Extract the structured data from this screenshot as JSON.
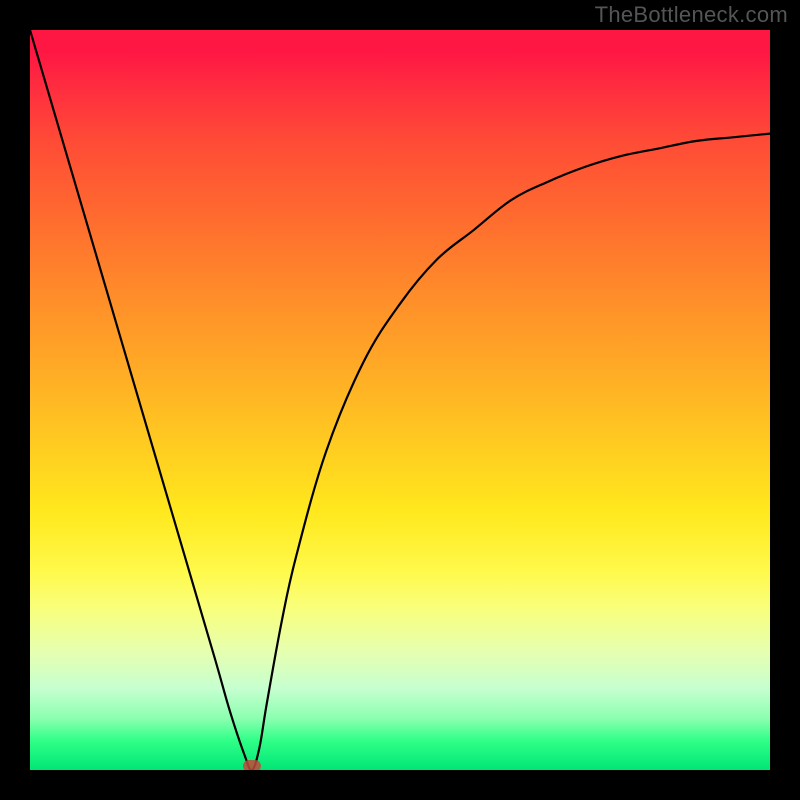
{
  "watermark": "TheBottleneck.com",
  "chart_data": {
    "type": "line",
    "title": "",
    "xlabel": "",
    "ylabel": "",
    "xlim": [
      0,
      100
    ],
    "ylim": [
      0,
      100
    ],
    "x": [
      0,
      5,
      10,
      15,
      20,
      25,
      27,
      29,
      30,
      31,
      32,
      34,
      36,
      40,
      45,
      50,
      55,
      60,
      65,
      70,
      75,
      80,
      85,
      90,
      95,
      100
    ],
    "values": [
      100,
      83,
      66,
      49,
      32,
      15,
      8,
      2,
      0,
      3,
      9,
      20,
      29,
      43,
      55,
      63,
      69,
      73,
      77,
      79.5,
      81.5,
      83,
      84,
      85,
      85.5,
      86
    ],
    "marker": {
      "x": 30,
      "y": 0
    }
  },
  "colors": {
    "curve": "#000000",
    "marker": "#c04a3a",
    "frame": "#000000"
  }
}
